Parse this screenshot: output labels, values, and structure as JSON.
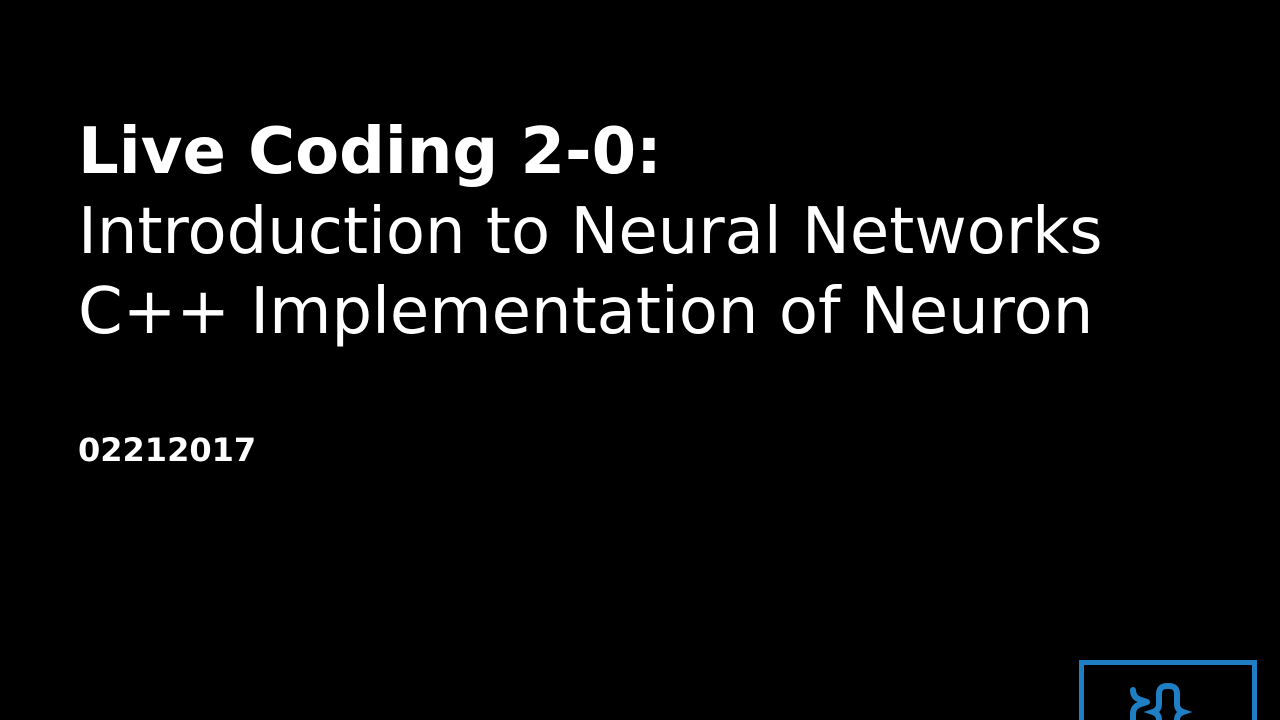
{
  "slide": {
    "title_line_1": "Live Coding 2-0:",
    "title_line_2": "Introduction to Neural Networks",
    "title_line_3": "C++ Implementation of Neuron",
    "date": "02212017"
  },
  "logo": {
    "icon": "braces-logo-icon",
    "color": "#1f7fc4"
  }
}
